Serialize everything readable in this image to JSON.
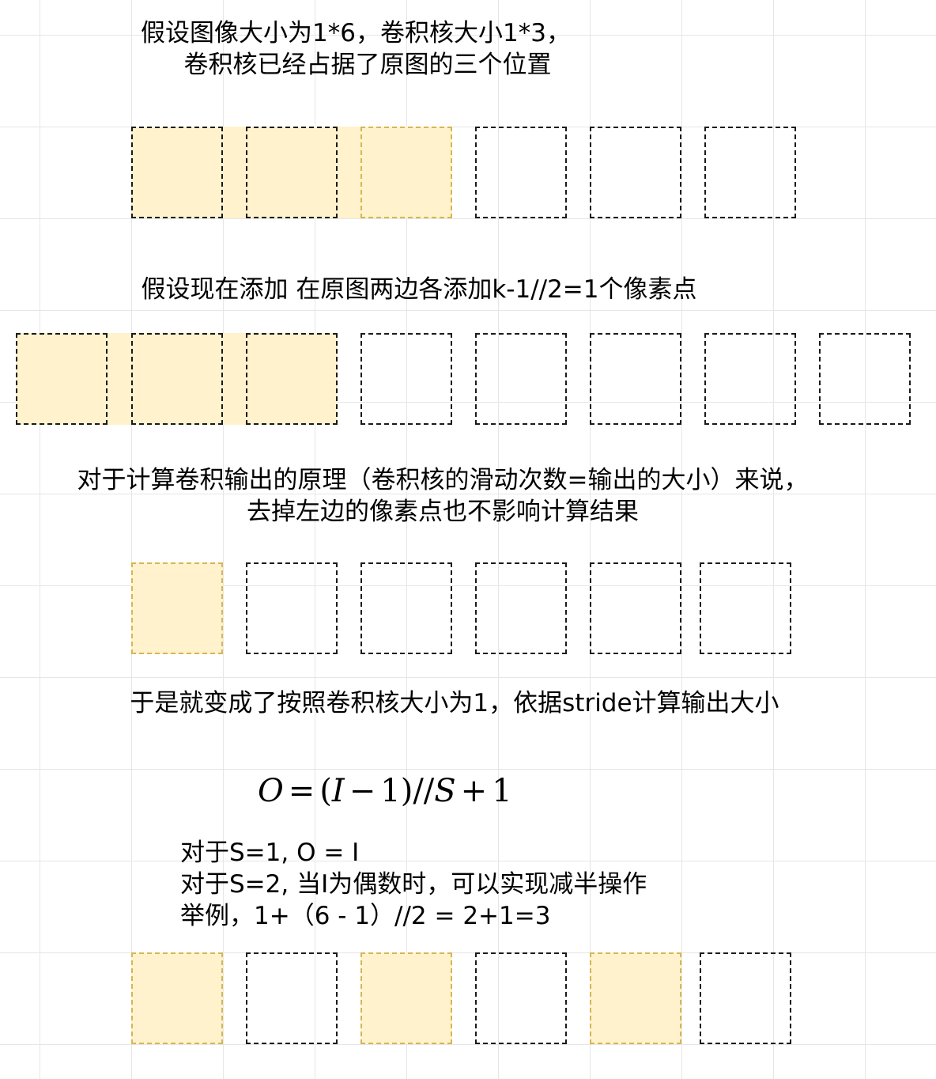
{
  "texts": {
    "line1": "假设图像大小为1*6，卷积核大小1*3，",
    "line2": "卷积核已经占据了原图的三个位置",
    "line3": "假设现在添加 在原图两边各添加k-1//2=1个像素点",
    "line4": "对于计算卷积输出的原理（卷积核的滑动次数=输出的大小）来说，",
    "line5": "去掉左边的像素点也不影响计算结果",
    "line6": "于是就变成了按照卷积核大小为1，依据stride计算输出大小",
    "note1": "对于S=1, O = I",
    "note2": "对于S=2, 当I为偶数时，可以实现减半操作",
    "note3": "举例，1+（6 - 1）//2 = 2+1=3"
  },
  "formula": {
    "o": "O",
    "eq": "=",
    "lparen": "(",
    "i": "I",
    "minus": "−",
    "one_a": "1",
    "rparen": ")",
    "slashes": "//",
    "s": "S",
    "plus": "+",
    "one_b": "1"
  },
  "rows": [
    {
      "name": "kernel-on-original",
      "cells": 6,
      "highlighted": [
        0,
        1,
        2
      ]
    },
    {
      "name": "padded-image",
      "cells": 8,
      "highlighted": [
        0,
        1,
        2
      ]
    },
    {
      "name": "kernel-size-one",
      "cells": 6,
      "highlighted": [
        0
      ]
    },
    {
      "name": "stride-two-example",
      "cells": 6,
      "highlighted": [
        0,
        2,
        4
      ]
    }
  ],
  "colors": {
    "highlight_fill": "#fff2cc",
    "highlight_border": "#d6b656",
    "dash_border": "#1a1a1a",
    "grid": "#e6e6e6"
  }
}
